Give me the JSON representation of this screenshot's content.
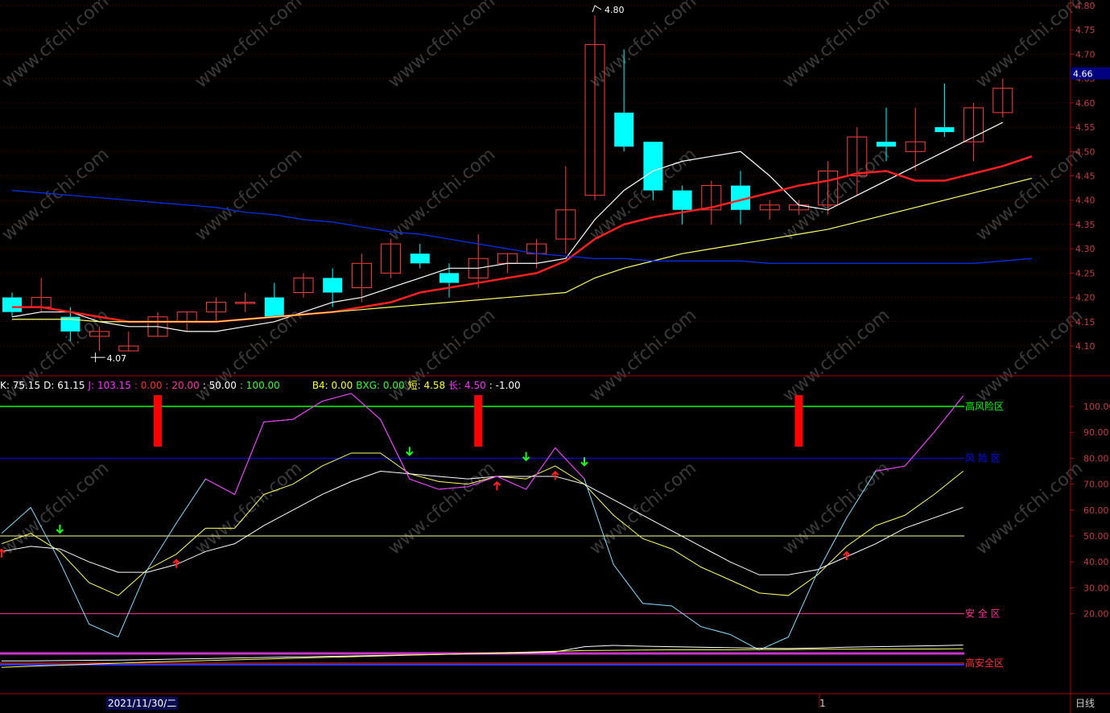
{
  "chart_data": [
    {
      "type": "candlestick",
      "ylim": [
        4.05,
        4.8
      ],
      "y_ticks": [
        "4.80",
        "4.75",
        "4.70",
        "4.65",
        "4.60",
        "4.55",
        "4.50",
        "4.45",
        "4.40",
        "4.35",
        "4.30",
        "4.25",
        "4.20",
        "4.15",
        "4.10"
      ],
      "last_price": "4.66",
      "high_label": "4.80",
      "low_label": "4.07",
      "candles": [
        {
          "o": 4.2,
          "h": 4.21,
          "l": 4.16,
          "c": 4.17
        },
        {
          "o": 4.18,
          "h": 4.24,
          "l": 4.17,
          "c": 4.2
        },
        {
          "o": 4.16,
          "h": 4.18,
          "l": 4.11,
          "c": 4.13
        },
        {
          "o": 4.12,
          "h": 4.14,
          "l": 4.09,
          "c": 4.13
        },
        {
          "o": 4.09,
          "h": 4.13,
          "l": 4.09,
          "c": 4.1
        },
        {
          "o": 4.12,
          "h": 4.17,
          "l": 4.12,
          "c": 4.16
        },
        {
          "o": 4.15,
          "h": 4.17,
          "l": 4.13,
          "c": 4.17
        },
        {
          "o": 4.17,
          "h": 4.2,
          "l": 4.15,
          "c": 4.19
        },
        {
          "o": 4.19,
          "h": 4.21,
          "l": 4.17,
          "c": 4.19
        },
        {
          "o": 4.2,
          "h": 4.23,
          "l": 4.16,
          "c": 4.16
        },
        {
          "o": 4.21,
          "h": 4.25,
          "l": 4.2,
          "c": 4.24
        },
        {
          "o": 4.24,
          "h": 4.26,
          "l": 4.18,
          "c": 4.21
        },
        {
          "o": 4.22,
          "h": 4.29,
          "l": 4.19,
          "c": 4.27
        },
        {
          "o": 4.25,
          "h": 4.32,
          "l": 4.24,
          "c": 4.31
        },
        {
          "o": 4.29,
          "h": 4.31,
          "l": 4.26,
          "c": 4.27
        },
        {
          "o": 4.25,
          "h": 4.27,
          "l": 4.2,
          "c": 4.23
        },
        {
          "o": 4.24,
          "h": 4.33,
          "l": 4.22,
          "c": 4.28
        },
        {
          "o": 4.27,
          "h": 4.29,
          "l": 4.25,
          "c": 4.29
        },
        {
          "o": 4.29,
          "h": 4.32,
          "l": 4.26,
          "c": 4.31
        },
        {
          "o": 4.32,
          "h": 4.47,
          "l": 4.29,
          "c": 4.38
        },
        {
          "o": 4.41,
          "h": 4.78,
          "l": 4.4,
          "c": 4.72
        },
        {
          "o": 4.58,
          "h": 4.71,
          "l": 4.5,
          "c": 4.51
        },
        {
          "o": 4.52,
          "h": 4.52,
          "l": 4.4,
          "c": 4.42
        },
        {
          "o": 4.42,
          "h": 4.43,
          "l": 4.35,
          "c": 4.38
        },
        {
          "o": 4.38,
          "h": 4.44,
          "l": 4.35,
          "c": 4.43
        },
        {
          "o": 4.43,
          "h": 4.46,
          "l": 4.35,
          "c": 4.38
        },
        {
          "o": 4.38,
          "h": 4.4,
          "l": 4.36,
          "c": 4.39
        },
        {
          "o": 4.38,
          "h": 4.4,
          "l": 4.37,
          "c": 4.39
        },
        {
          "o": 4.39,
          "h": 4.48,
          "l": 4.37,
          "c": 4.46
        },
        {
          "o": 4.45,
          "h": 4.55,
          "l": 4.41,
          "c": 4.53
        },
        {
          "o": 4.52,
          "h": 4.59,
          "l": 4.48,
          "c": 4.51
        },
        {
          "o": 4.5,
          "h": 4.59,
          "l": 4.46,
          "c": 4.52
        },
        {
          "o": 4.55,
          "h": 4.64,
          "l": 4.53,
          "c": 4.54
        },
        {
          "o": 4.52,
          "h": 4.6,
          "l": 4.48,
          "c": 4.59
        },
        {
          "o": 4.58,
          "h": 4.65,
          "l": 4.57,
          "c": 4.63
        }
      ],
      "series": [
        {
          "color": "#ffffff",
          "values": [
            4.16,
            4.17,
            4.17,
            4.15,
            4.14,
            4.14,
            4.13,
            4.13,
            4.14,
            4.15,
            4.17,
            4.19,
            4.2,
            4.22,
            4.24,
            4.26,
            4.26,
            4.27,
            4.27,
            4.28,
            4.36,
            4.42,
            4.46,
            4.48,
            4.49,
            4.5,
            4.45,
            4.39,
            4.38,
            4.41,
            4.44,
            4.47,
            4.5,
            4.53,
            4.56
          ]
        },
        {
          "color": "#ff2020",
          "values": [
            4.18,
            4.18,
            4.17,
            4.16,
            4.15,
            4.15,
            4.15,
            4.15,
            4.155,
            4.16,
            4.165,
            4.17,
            4.18,
            4.19,
            4.21,
            4.22,
            4.23,
            4.24,
            4.25,
            4.275,
            4.32,
            4.35,
            4.365,
            4.375,
            4.385,
            4.4,
            4.415,
            4.43,
            4.44,
            4.455,
            4.46,
            4.44,
            4.44,
            4.455,
            4.47,
            4.49
          ]
        },
        {
          "color": "#ffff66",
          "values": [
            4.155,
            4.155,
            4.155,
            4.15,
            4.15,
            4.15,
            4.15,
            4.15,
            4.155,
            4.16,
            4.165,
            4.17,
            4.175,
            4.18,
            4.185,
            4.19,
            4.195,
            4.2,
            4.205,
            4.21,
            4.24,
            4.26,
            4.275,
            4.29,
            4.3,
            4.31,
            4.32,
            4.33,
            4.34,
            4.355,
            4.37,
            4.385,
            4.4,
            4.415,
            4.43,
            4.445
          ]
        },
        {
          "color": "#0033ff",
          "values": [
            4.42,
            4.415,
            4.41,
            4.405,
            4.4,
            4.395,
            4.39,
            4.385,
            4.375,
            4.37,
            4.36,
            4.355,
            4.345,
            4.335,
            4.33,
            4.32,
            4.31,
            4.3,
            4.29,
            4.285,
            4.28,
            4.28,
            4.275,
            4.275,
            4.275,
            4.275,
            4.27,
            4.27,
            4.27,
            4.27,
            4.27,
            4.27,
            4.27,
            4.27,
            4.275,
            4.28
          ]
        }
      ]
    },
    {
      "type": "line",
      "ylim": [
        0,
        115
      ],
      "y_ticks": [
        "100.00",
        "90.00",
        "80.00",
        "70.00",
        "60.00",
        "50.00",
        "40.00",
        "30.00",
        "20.00"
      ],
      "legend": [
        {
          "text": "K: 75.15",
          "color": "#ffffff"
        },
        {
          "text": "D: 61.15",
          "color": "#ffffff"
        },
        {
          "text": "J: 103.15",
          "color": "#ff33ff"
        },
        {
          "text": ": 0.00",
          "color": "#ff3333"
        },
        {
          "text": ": 20.00",
          "color": "#ff33aa"
        },
        {
          "text": ": 50.00",
          "color": "#ffffff"
        },
        {
          "text": ": 100.00",
          "color": "#33ff33"
        },
        {
          "text": "B4: 0.00",
          "color": "#ffff33"
        },
        {
          "text": "BXG: 0.00",
          "color": "#33ff33"
        },
        {
          "text": "短: 4.58",
          "color": "#ffff33"
        },
        {
          "text": "长: 4.50",
          "color": "#ff33ff"
        },
        {
          "text": ": -1.00",
          "color": "#ffffff"
        }
      ],
      "zones": [
        {
          "value": 100,
          "label": "高风险区",
          "color": "#00ff00"
        },
        {
          "value": 80,
          "label": "风 险 区",
          "color": "#0000ff"
        },
        {
          "value": 50,
          "label": "",
          "color": "#ffff99"
        },
        {
          "value": 20,
          "label": "安 全 区",
          "color": "#ff3399"
        },
        {
          "value": 1,
          "label": "高安全区",
          "color": "#ff3333"
        }
      ],
      "signal_bars_at": [
        5,
        16,
        27
      ],
      "up_arrows_at": [
        0,
        6,
        17,
        19,
        29
      ],
      "down_arrows_at": [
        2,
        14,
        18,
        20
      ],
      "series": [
        {
          "name": "K",
          "color": "#ffff66",
          "values": [
            47,
            51,
            44,
            32,
            27,
            37,
            43,
            53,
            53,
            66,
            70,
            77,
            82,
            82,
            74,
            71,
            70,
            73,
            72,
            77,
            70,
            58,
            49,
            45,
            38,
            33,
            28,
            27,
            35,
            46,
            54,
            58,
            66,
            75
          ]
        },
        {
          "name": "D",
          "color": "#ffffff",
          "values": [
            44,
            46,
            45,
            40,
            36,
            36,
            39,
            44,
            47,
            54,
            60,
            66,
            71,
            75,
            74,
            73,
            72,
            73,
            73,
            73,
            70,
            64,
            58,
            52,
            46,
            40,
            35,
            35,
            37,
            42,
            47,
            53,
            57,
            61
          ]
        },
        {
          "name": "J",
          "color": "#88ddff",
          "values": [
            51,
            61,
            40,
            16,
            11,
            37,
            55,
            72,
            66,
            94,
            95,
            102,
            105,
            95,
            72,
            68,
            69,
            73,
            68,
            84,
            72,
            39,
            24,
            23,
            15,
            12,
            6,
            11,
            36,
            57,
            75,
            77,
            90,
            104
          ]
        }
      ],
      "bottom_lines": [
        {
          "color": "#ffffff",
          "values": [
            1.5,
            1.5,
            1.6,
            1.7,
            1.8,
            2.0,
            2.2,
            2.4,
            2.6,
            2.8,
            3.0,
            3.2,
            3.4,
            3.6,
            3.8,
            4.0,
            4.2,
            4.4,
            4.6,
            5.0,
            7.0,
            7.5,
            7.2,
            7.0,
            6.8,
            6.6,
            6.4,
            6.3,
            6.5,
            6.8,
            7.0,
            7.2,
            7.4,
            7.6
          ]
        },
        {
          "color": "#ffff66",
          "values": [
            -1,
            -0.6,
            -0.2,
            0.2,
            0.6,
            1.0,
            1.3,
            1.6,
            1.9,
            2.2,
            2.5,
            2.8,
            3.1,
            3.4,
            3.7,
            4.0,
            4.3,
            4.6,
            4.9,
            5.2,
            5.5,
            5.6,
            5.7,
            5.8,
            5.8,
            5.8,
            5.9,
            5.9,
            6.0,
            6.0,
            6.1,
            6.1,
            6.1,
            6.2
          ]
        }
      ]
    }
  ],
  "x_labels": {
    "date": "2021/11/30/二",
    "tick": "1"
  },
  "corner_label": "日线",
  "watermark": "www.cfchi.com"
}
